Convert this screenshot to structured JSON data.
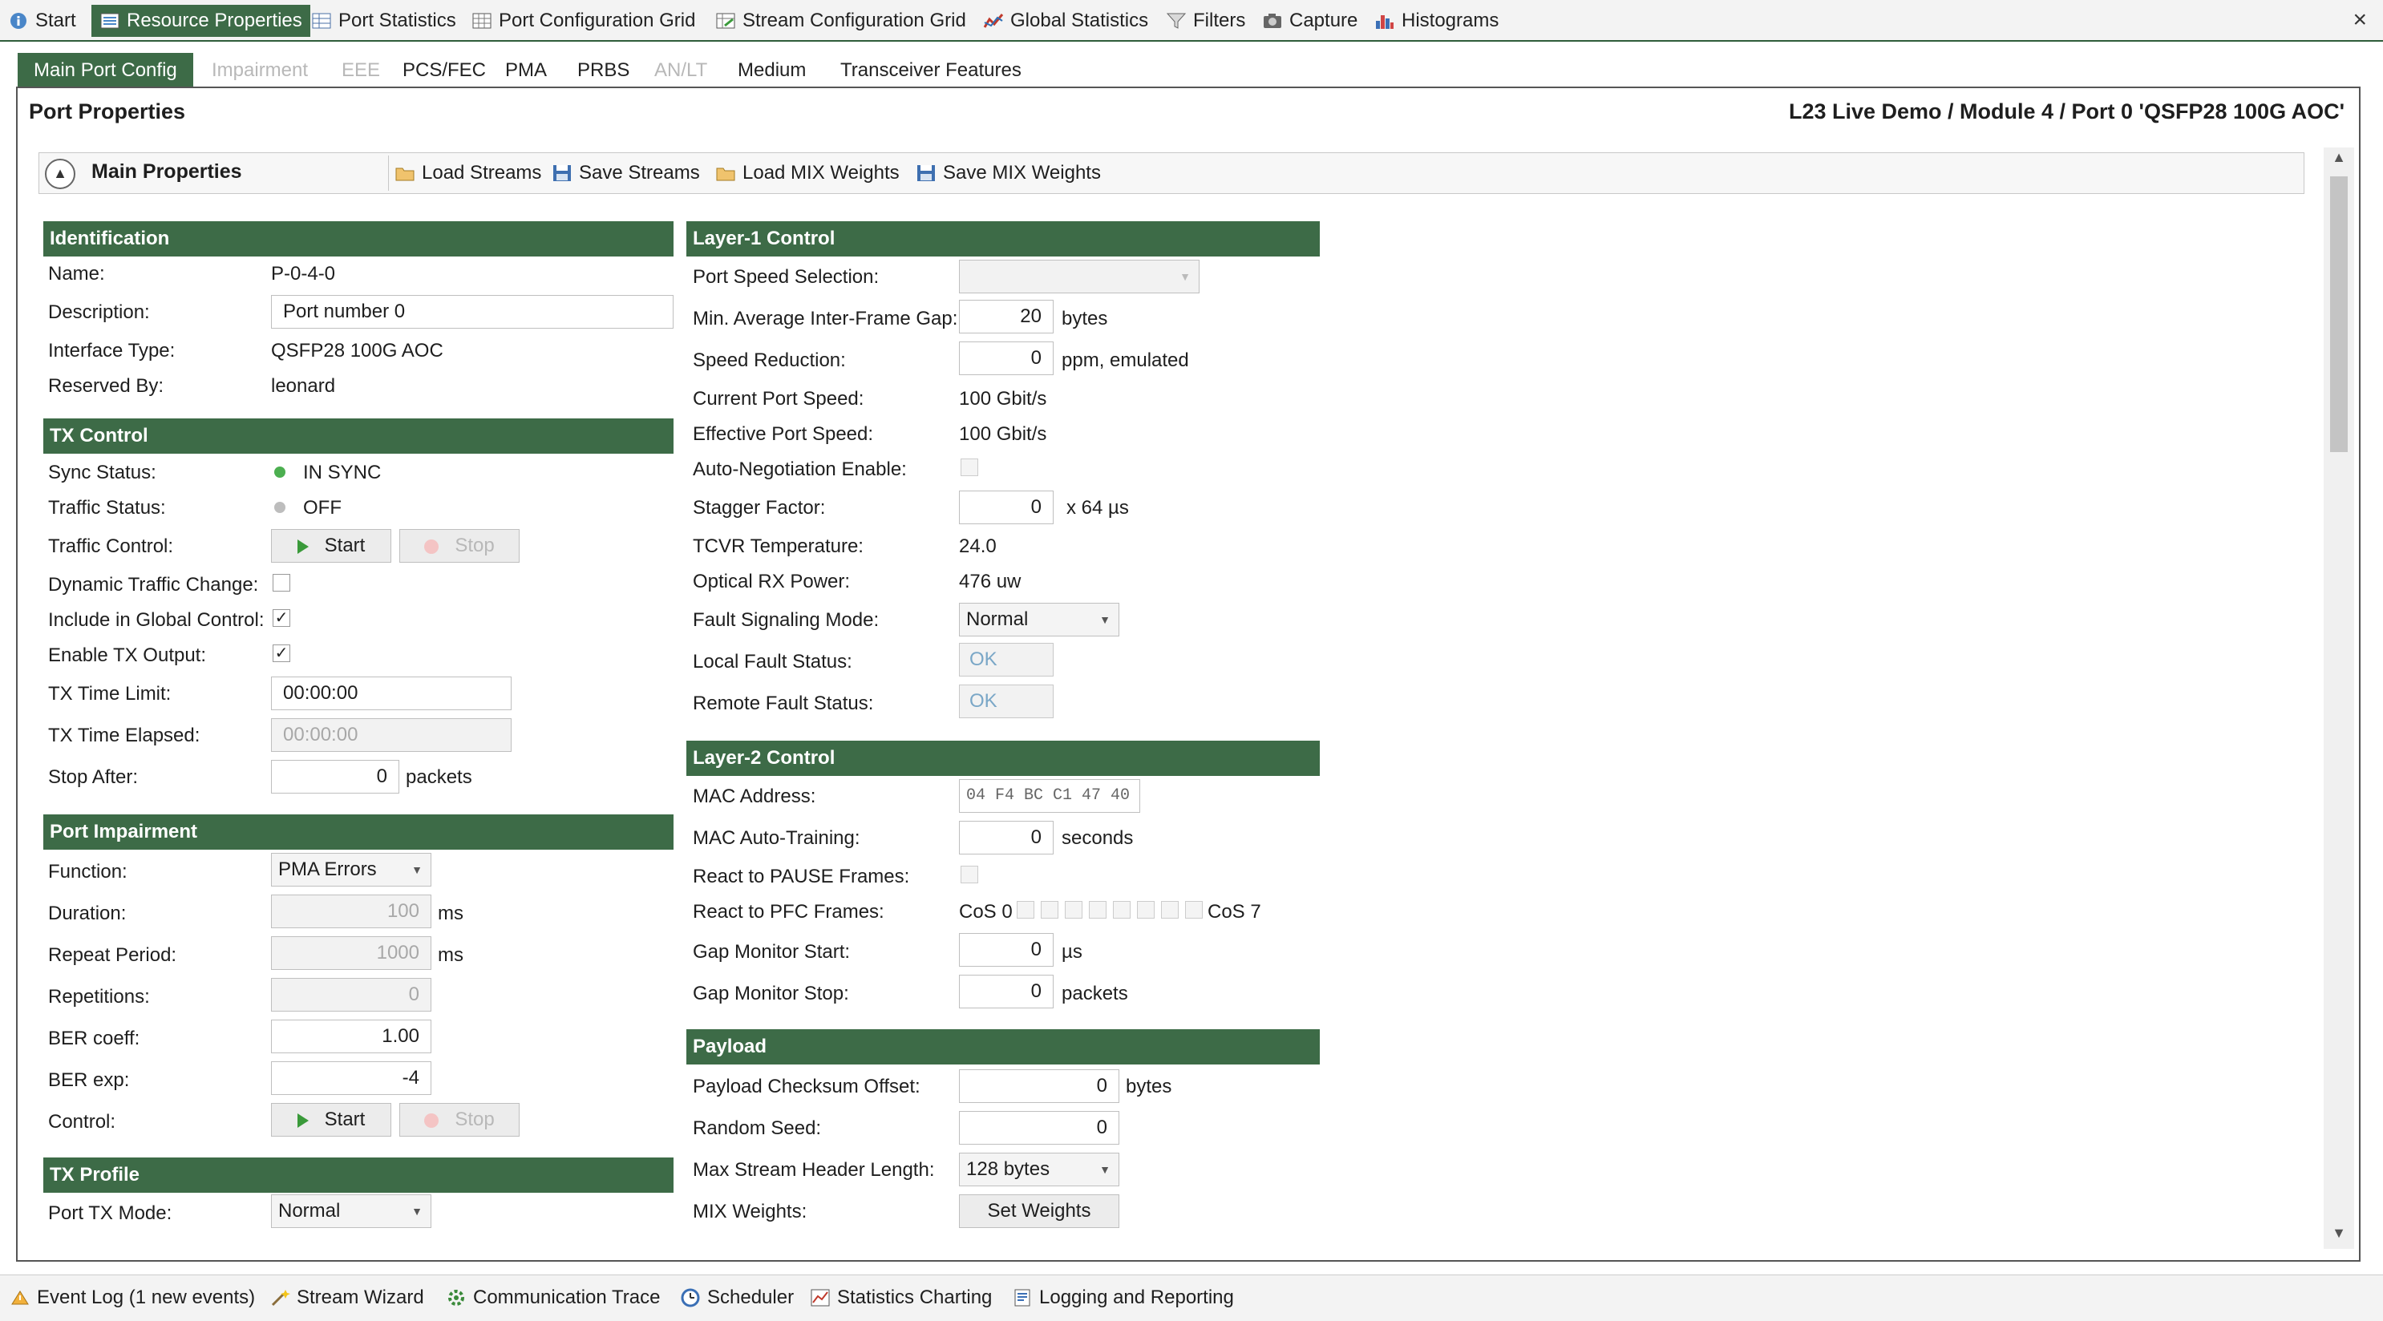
{
  "top_tabs": [
    {
      "label": "Start",
      "icon": "info-icon"
    },
    {
      "label": "Resource Properties",
      "icon": "properties-icon"
    },
    {
      "label": "Port Statistics",
      "icon": "table-icon"
    },
    {
      "label": "Port Configuration Grid",
      "icon": "grid-icon"
    },
    {
      "label": "Stream Configuration Grid",
      "icon": "stream-grid-icon"
    },
    {
      "label": "Global Statistics",
      "icon": "chart-line-icon"
    },
    {
      "label": "Filters",
      "icon": "filter-icon"
    },
    {
      "label": "Capture",
      "icon": "camera-icon"
    },
    {
      "label": "Histograms",
      "icon": "histogram-icon"
    }
  ],
  "close_symbol": "×",
  "sub_tabs": [
    "Main Port Config",
    "Impairment",
    "EEE",
    "PCS/FEC",
    "PMA",
    "PRBS",
    "AN/LT",
    "Medium",
    "Transceiver Features"
  ],
  "header": {
    "title": "Port Properties",
    "path": "L23 Live Demo / Module 4 / Port 0 'QSFP28 100G AOC'"
  },
  "main_props": {
    "label": "Main Properties",
    "collapse_symbol": "▲",
    "load_streams": "Load Streams",
    "save_streams": "Save Streams",
    "load_mix": "Load MIX Weights",
    "save_mix": "Save MIX Weights"
  },
  "identification": {
    "title": "Identification",
    "name_label": "Name:",
    "name": "P-0-4-0",
    "desc_label": "Description:",
    "desc": "Port number 0",
    "iface_label": "Interface Type:",
    "iface": "QSFP28 100G AOC",
    "reserved_label": "Reserved By:",
    "reserved": "leonard"
  },
  "tx_control": {
    "title": "TX Control",
    "sync_label": "Sync Status:",
    "sync": "IN SYNC",
    "sync_color": "#4caf50",
    "traffic_label": "Traffic Status:",
    "traffic": "OFF",
    "traffic_color": "#bdbdbd",
    "control_label": "Traffic Control:",
    "start": "Start",
    "stop": "Stop",
    "dynamic_label": "Dynamic Traffic Change:",
    "include_label": "Include in Global Control:",
    "enable_label": "Enable TX Output:",
    "check": "✓",
    "limit_label": "TX Time Limit:",
    "limit": "00:00:00",
    "elapsed_label": "TX Time Elapsed:",
    "elapsed": "00:00:00",
    "stop_after_label": "Stop After:",
    "stop_after": "0",
    "packets": "packets"
  },
  "impairment": {
    "title": "Port Impairment",
    "function_label": "Function:",
    "function": "PMA Errors",
    "duration_label": "Duration:",
    "duration": "100",
    "ms": "ms",
    "repeat_label": "Repeat Period:",
    "repeat": "1000",
    "reps_label": "Repetitions:",
    "reps": "0",
    "ber_coeff_label": "BER coeff:",
    "ber_coeff": "1.00",
    "ber_exp_label": "BER exp:",
    "ber_exp": "-4",
    "control_label": "Control:",
    "start": "Start",
    "stop": "Stop"
  },
  "tx_profile": {
    "title": "TX Profile",
    "mode_label": "Port TX Mode:",
    "mode": "Normal"
  },
  "layer1": {
    "title": "Layer-1 Control",
    "speed_sel_label": "Port Speed Selection:",
    "ifg_label": "Min. Average Inter-Frame Gap:",
    "ifg": "20",
    "bytes": "bytes",
    "speed_red_label": "Speed Reduction:",
    "speed_red": "0",
    "ppm": "ppm, emulated",
    "cur_speed_label": "Current Port Speed:",
    "cur_speed": "100 Gbit/s",
    "eff_speed_label": "Effective Port Speed:",
    "eff_speed": "100 Gbit/s",
    "autoneg_label": "Auto-Negotiation Enable:",
    "stagger_label": "Stagger Factor:",
    "stagger": "0",
    "stagger_unit": "x 64 µs",
    "tcvr_label": "TCVR Temperature:",
    "tcvr": "24.0",
    "optical_label": "Optical RX Power:",
    "optical": "476 uw",
    "fault_mode_label": "Fault Signaling Mode:",
    "fault_mode": "Normal",
    "local_label": "Local Fault Status:",
    "local": "OK",
    "remote_label": "Remote Fault Status:",
    "remote": "OK"
  },
  "layer2": {
    "title": "Layer-2 Control",
    "mac_label": "MAC Address:",
    "mac": "04 F4 BC C1 47 40",
    "auto_label": "MAC Auto-Training:",
    "auto": "0",
    "seconds": "seconds",
    "pause_label": "React to PAUSE Frames:",
    "pfc_label": "React to PFC Frames:",
    "cos0": "CoS 0",
    "cos7": "CoS 7",
    "gap_start_label": "Gap Monitor Start:",
    "gap_start": "0",
    "us": "µs",
    "gap_stop_label": "Gap Monitor Stop:",
    "gap_stop": "0",
    "packets": "packets"
  },
  "payload": {
    "title": "Payload",
    "checksum_label": "Payload Checksum Offset:",
    "checksum": "0",
    "bytes": "bytes",
    "seed_label": "Random Seed:",
    "seed": "0",
    "maxhdr_label": "Max Stream Header Length:",
    "maxhdr": "128 bytes",
    "mix_label": "MIX Weights:",
    "set_weights": "Set Weights"
  },
  "bottom_tabs": [
    {
      "label": "Event Log (1 new events)",
      "icon": "event-log-icon"
    },
    {
      "label": "Stream Wizard",
      "icon": "wand-icon"
    },
    {
      "label": "Communication Trace",
      "icon": "gear-trace-icon"
    },
    {
      "label": "Scheduler",
      "icon": "clock-icon"
    },
    {
      "label": "Statistics Charting",
      "icon": "chart-icon"
    },
    {
      "label": "Logging and Reporting",
      "icon": "report-icon"
    }
  ]
}
